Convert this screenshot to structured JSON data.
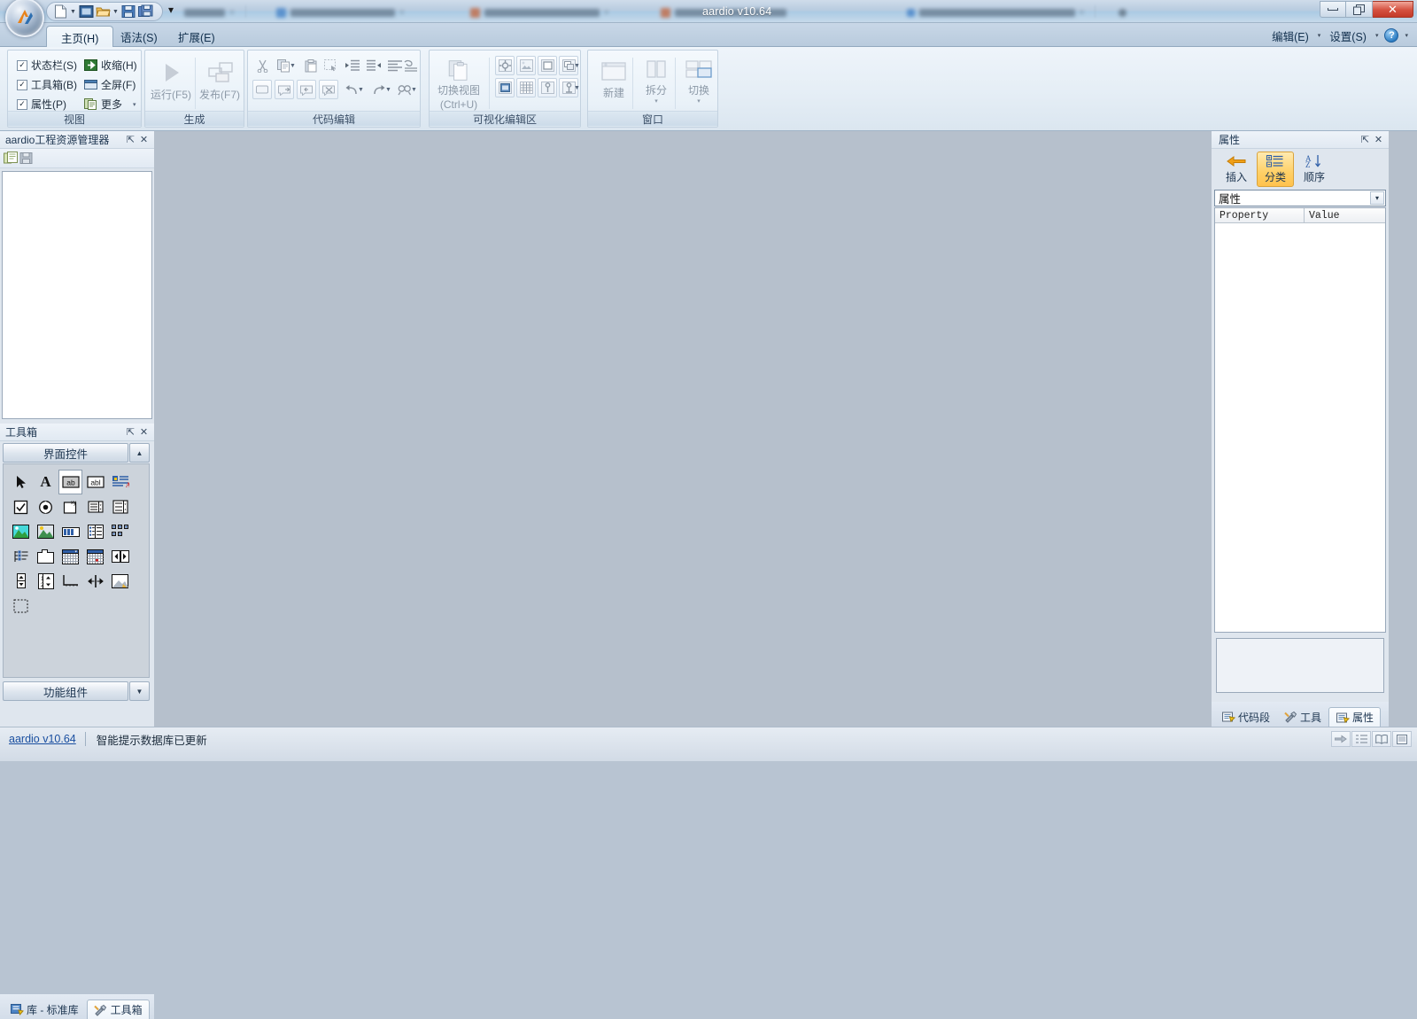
{
  "app": {
    "title": "aardio v10.64",
    "tooltip": "aardio v10.64"
  },
  "titlebar": {
    "quick_access": [
      {
        "name": "new-file-icon",
        "label": "新建"
      },
      {
        "name": "new-dropdown-arrow",
        "label": "▾"
      },
      {
        "name": "window-designer-icon",
        "label": "窗口"
      },
      {
        "name": "open-folder-icon",
        "label": "打开"
      },
      {
        "name": "open-dropdown-arrow",
        "label": "▾"
      },
      {
        "name": "save-icon",
        "label": "保存"
      },
      {
        "name": "save-all-icon",
        "label": "全部保存"
      }
    ],
    "customize_arrow": "▾",
    "window_buttons": {
      "minimize": "—",
      "maximize": "❐",
      "close": "✕"
    }
  },
  "ribbon": {
    "tabs": [
      {
        "label": "主页(H)",
        "active": true
      },
      {
        "label": "语法(S)",
        "active": false
      },
      {
        "label": "扩展(E)",
        "active": false
      }
    ],
    "right_items": [
      {
        "label": "编辑(E)",
        "arrow": "▾"
      },
      {
        "label": "设置(S)",
        "arrow": "▾"
      }
    ],
    "help_glyph": "?",
    "help_arrow": "▾",
    "groups": [
      {
        "name": "view",
        "label": "视图",
        "checkboxes": [
          {
            "label": "状态栏(S)",
            "checked": true
          },
          {
            "label": "工具箱(B)",
            "checked": true
          },
          {
            "label": "属性(P)",
            "checked": true
          }
        ],
        "commands": [
          {
            "label": "收缩(H)",
            "icon": "collapse-icon"
          },
          {
            "label": "全屏(F)",
            "icon": "fullscreen-icon"
          },
          {
            "label": "更多",
            "icon": "more-icon",
            "arrow": "▾"
          }
        ]
      },
      {
        "name": "build",
        "label": "生成",
        "buttons": [
          {
            "label": "运行(F5)",
            "icon": "run-icon",
            "enabled": false
          },
          {
            "label": "发布(F7)",
            "icon": "publish-icon",
            "enabled": false
          }
        ]
      },
      {
        "name": "code-edit",
        "label": "代码编辑",
        "row1": [
          "cut-icon",
          "copy-icon",
          "copy-dropdown",
          "paste-icon",
          "select-all-icon",
          "indent-icon",
          "outdent-icon",
          "align-left-icon",
          "format-icon"
        ],
        "row2": [
          "comment-icon",
          "uncomment-block-icon",
          "undo-comment-icon",
          "remove-comment-icon",
          "undo-icon",
          "undo-dropdown",
          "redo-icon",
          "redo-dropdown",
          "find-icon",
          "find-dropdown"
        ]
      },
      {
        "name": "visual-editor",
        "label": "可视化编辑区",
        "toggle_label_line1": "切换视图",
        "toggle_label_line2": "(Ctrl+U)",
        "row1": [
          "control-props-icon",
          "control-image-icon",
          "frame-icon",
          "layers-icon",
          "layers-dropdown"
        ],
        "row2": [
          "form-icon",
          "grid-icon",
          "pin-v-icon",
          "pin-h-icon",
          "pin-dropdown"
        ]
      },
      {
        "name": "window",
        "label": "窗口",
        "buttons": [
          {
            "label": "新建",
            "icon": "new-window-icon"
          },
          {
            "label": "拆分",
            "icon": "split-icon",
            "arrow": "▾"
          },
          {
            "label": "切换",
            "icon": "switch-icon",
            "arrow": "▾"
          }
        ]
      }
    ]
  },
  "project_panel": {
    "title": "aardio工程资源管理器",
    "pin": "⇱",
    "close": "✕",
    "toolbar": [
      {
        "name": "project-explorer-icon"
      },
      {
        "name": "save-project-icon"
      }
    ],
    "tree_items": []
  },
  "toolbox_panel": {
    "title": "工具箱",
    "pin": "⇱",
    "close": "✕",
    "sections": [
      {
        "label": "界面控件",
        "scroll": "▲",
        "expanded": true
      },
      {
        "label": "功能组件",
        "scroll": "▼",
        "expanded": false
      }
    ],
    "controls": [
      {
        "name": "pointer-tool",
        "selected": false
      },
      {
        "name": "static-text-tool",
        "selected": false
      },
      {
        "name": "edit-box-tool",
        "selected": true
      },
      {
        "name": "multiline-edit-tool",
        "selected": false
      },
      {
        "name": "rich-edit-tool",
        "selected": false
      },
      {
        "name": "checkbox-tool",
        "selected": false
      },
      {
        "name": "radio-button-tool",
        "selected": false
      },
      {
        "name": "plot-tool",
        "selected": false
      },
      {
        "name": "combobox-tool",
        "selected": false
      },
      {
        "name": "listbox-combo-tool",
        "selected": false
      },
      {
        "name": "picture-tool",
        "selected": false
      },
      {
        "name": "image-button-tool",
        "selected": false
      },
      {
        "name": "progress-bar-tool",
        "selected": false
      },
      {
        "name": "listview-tool",
        "selected": false
      },
      {
        "name": "tile-list-tool",
        "selected": false
      },
      {
        "name": "treeview-tool",
        "selected": false
      },
      {
        "name": "tab-control-tool",
        "selected": false
      },
      {
        "name": "calendar-tool",
        "selected": false
      },
      {
        "name": "date-picker-tool",
        "selected": false
      },
      {
        "name": "paging-tool",
        "selected": false
      },
      {
        "name": "updown-tool",
        "selected": false
      },
      {
        "name": "spinner-list-tool",
        "selected": false
      },
      {
        "name": "trackbar-tool",
        "selected": false
      },
      {
        "name": "splitter-tool",
        "selected": false
      },
      {
        "name": "custom-draw-tool",
        "selected": false
      },
      {
        "name": "placeholder-tool",
        "selected": false
      }
    ],
    "bottom_tabs": [
      {
        "label": "库 - 标准库",
        "icon": "library-icon",
        "active": false
      },
      {
        "label": "工具箱",
        "icon": "toolbox-icon",
        "active": true
      }
    ]
  },
  "property_panel": {
    "title": "属性",
    "pin": "⇱",
    "close": "✕",
    "toolbar": [
      {
        "label": "插入",
        "icon": "insert-arrow-icon",
        "selected": false
      },
      {
        "label": "分类",
        "icon": "categorize-icon",
        "selected": true
      },
      {
        "label": "顺序",
        "icon": "sort-az-icon",
        "selected": false
      }
    ],
    "combo_value": "属性",
    "combo_arrow": "▾",
    "grid_headers": [
      "Property",
      "Value"
    ],
    "grid_rows": [],
    "description": "",
    "bottom_tabs": [
      {
        "label": "代码段",
        "icon": "snippet-icon",
        "active": false
      },
      {
        "label": "工具",
        "icon": "tools-icon",
        "active": false
      },
      {
        "label": "属性",
        "icon": "properties-icon",
        "active": true
      }
    ]
  },
  "status_bar": {
    "version_link": "aardio v10.64",
    "message": "智能提示数据库已更新",
    "right_buttons": [
      {
        "name": "goto-icon",
        "glyph": "➡"
      },
      {
        "name": "list-icon",
        "glyph": "≔"
      },
      {
        "name": "book-icon",
        "glyph": "📖"
      },
      {
        "name": "doc-icon",
        "glyph": "▤"
      }
    ]
  },
  "colors": {
    "accent": "#ffd066",
    "chrome": "#b9cce0",
    "canvas": "#b6c0cc",
    "link": "#1a4fa0"
  }
}
